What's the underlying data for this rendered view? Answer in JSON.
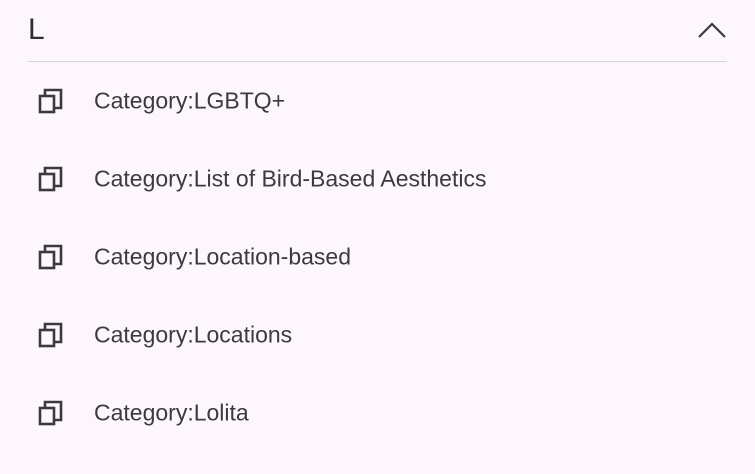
{
  "section": {
    "letter": "L",
    "expanded": true
  },
  "items": [
    {
      "label": "Category:LGBTQ+",
      "icon": "copy-icon"
    },
    {
      "label": "Category:List of Bird-Based Aesthetics",
      "icon": "copy-icon"
    },
    {
      "label": "Category:Location-based",
      "icon": "copy-icon"
    },
    {
      "label": "Category:Locations",
      "icon": "copy-icon"
    },
    {
      "label": "Category:Lolita",
      "icon": "copy-icon"
    }
  ],
  "colors": {
    "background": "#fdf7fb",
    "text": "#3b3a3f",
    "divider": "#d8d4da"
  }
}
